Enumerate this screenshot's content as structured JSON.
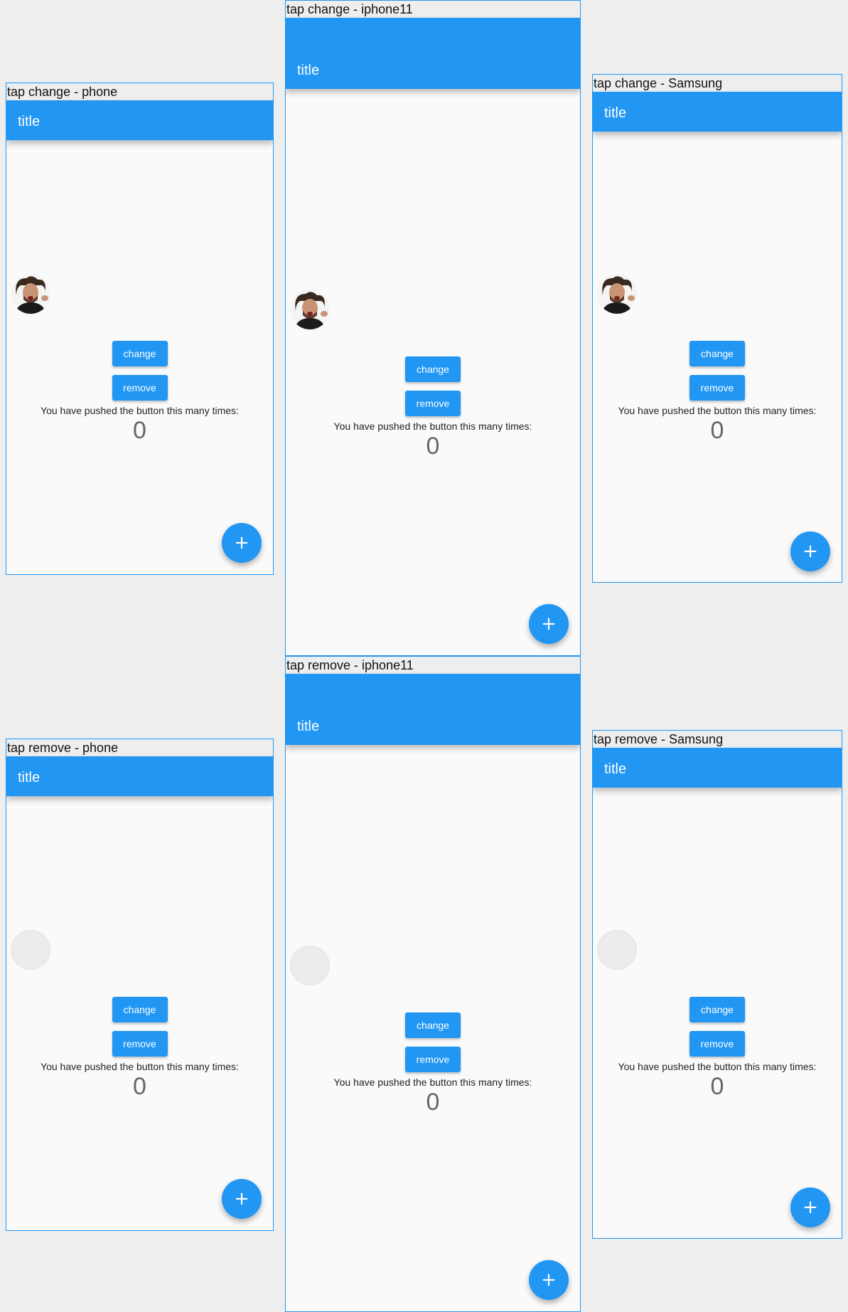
{
  "screens": [
    {
      "caption": "tap change - phone",
      "title": "title",
      "change_label": "change",
      "remove_label": "remove",
      "message": "You have pushed the button this many times:",
      "count": "0",
      "fab_icon": "+",
      "avatar": "photo"
    },
    {
      "caption": "tap change - iphone11",
      "title": "title",
      "change_label": "change",
      "remove_label": "remove",
      "message": "You have pushed the button this many times:",
      "count": "0",
      "fab_icon": "+",
      "avatar": "photo"
    },
    {
      "caption": "tap change - Samsung",
      "title": "title",
      "change_label": "change",
      "remove_label": "remove",
      "message": "You have pushed the button this many times:",
      "count": "0",
      "fab_icon": "+",
      "avatar": "photo"
    },
    {
      "caption": "tap remove - phone",
      "title": "title",
      "change_label": "change",
      "remove_label": "remove",
      "message": "You have pushed the button this many times:",
      "count": "0",
      "fab_icon": "+",
      "avatar": "empty"
    },
    {
      "caption": "tap remove - iphone11",
      "title": "title",
      "change_label": "change",
      "remove_label": "remove",
      "message": "You have pushed the button this many times:",
      "count": "0",
      "fab_icon": "+",
      "avatar": "empty"
    },
    {
      "caption": "tap remove - Samsung",
      "title": "title",
      "change_label": "change",
      "remove_label": "remove",
      "message": "You have pushed the button this many times:",
      "count": "0",
      "fab_icon": "+",
      "avatar": "empty"
    }
  ],
  "colors": {
    "primary": "#2196f3",
    "background": "#fafafa",
    "canvas": "#eeeeee"
  }
}
